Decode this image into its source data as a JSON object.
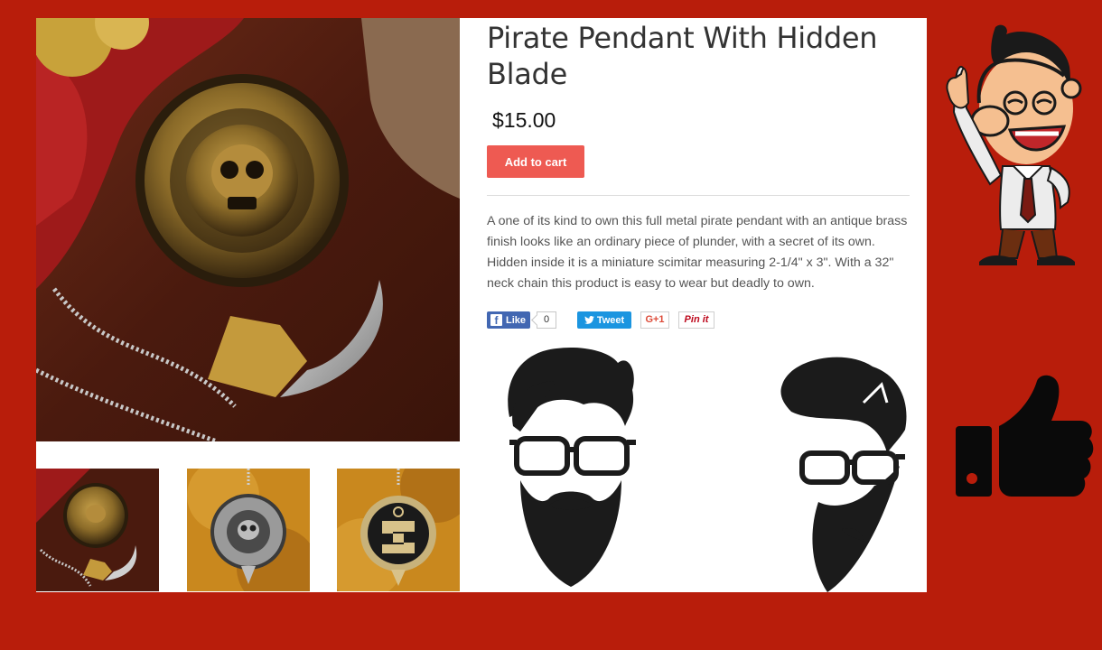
{
  "product": {
    "title": "Pirate Pendant With Hidden Blade",
    "price": "$15.00",
    "add_to_cart_label": "Add to cart",
    "description": "A one of its kind to own this full metal pirate pendant with an antique brass finish looks like an ordinary piece of plunder, with a secret of its own. Hidden inside it is a miniature scimitar measuring 2-1/4\" x 3\". With a 32\" neck chain this product is easy to wear but deadly to own."
  },
  "gallery": {
    "main_image": "pirate-pendant-with-blade-photo",
    "thumbnails": [
      "pendant-with-blade-thumbnail",
      "pendant-front-thumbnail",
      "pendant-back-thumbnail"
    ]
  },
  "share": {
    "facebook_icon": "f",
    "facebook_label": "Like",
    "facebook_count": "0",
    "twitter_label": "Tweet",
    "google_label": "G+1",
    "pinterest_label": "Pin it"
  },
  "colors": {
    "page_background": "#b81d0b",
    "button_red": "#ee5a52",
    "facebook_blue": "#4267b2",
    "twitter_blue": "#1b95e0"
  },
  "decorations": [
    "bearded-man-glasses-icon",
    "bearded-man-profile-icon",
    "laughing-cartoon-man-icon",
    "thumbs-up-icon"
  ]
}
